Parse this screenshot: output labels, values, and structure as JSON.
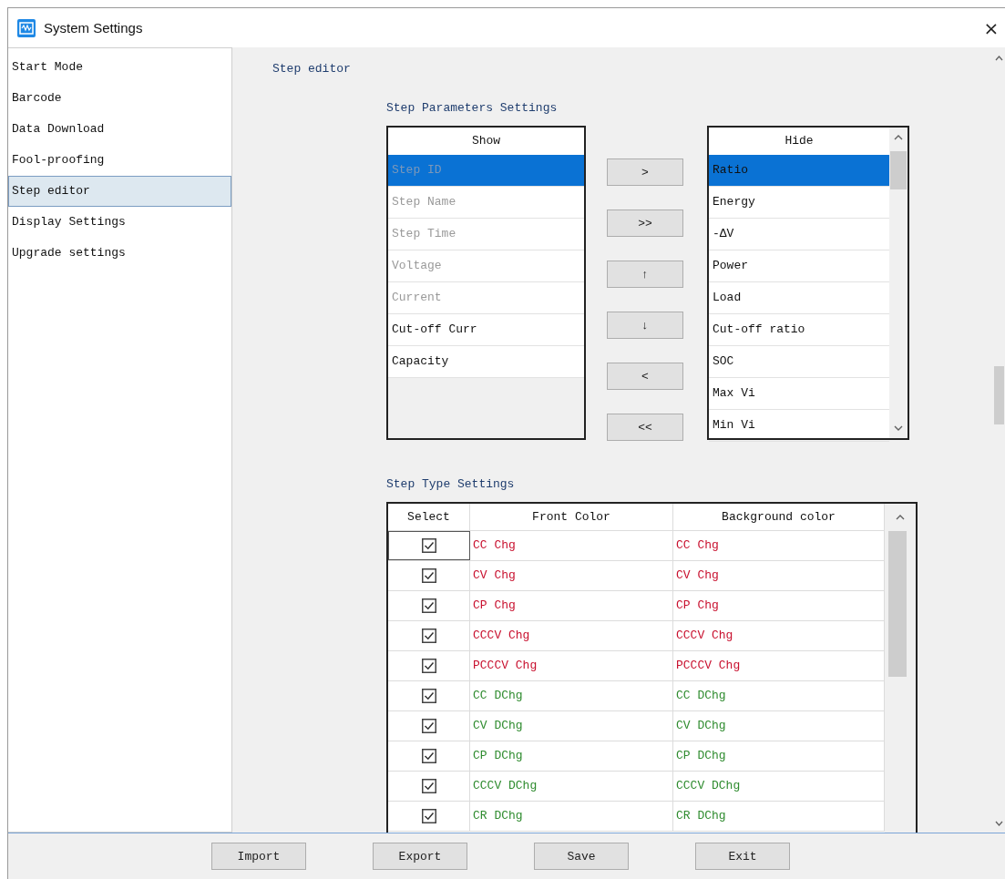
{
  "window": {
    "title": "System Settings",
    "close": "×"
  },
  "sidebar": {
    "items": [
      {
        "label": "Start Mode",
        "selected": false
      },
      {
        "label": "Barcode",
        "selected": false
      },
      {
        "label": "Data Download",
        "selected": false
      },
      {
        "label": "Fool-proofing",
        "selected": false
      },
      {
        "label": "Step editor",
        "selected": true
      },
      {
        "label": "Display Settings",
        "selected": false
      },
      {
        "label": "Upgrade settings",
        "selected": false
      }
    ]
  },
  "page_title": "Step editor",
  "step_parameters": {
    "title": "Step Parameters Settings",
    "show": {
      "header": "Show",
      "items": [
        {
          "label": "Step ID",
          "selected": true,
          "disabled": true
        },
        {
          "label": "Step Name",
          "selected": false,
          "disabled": true
        },
        {
          "label": "Step Time",
          "selected": false,
          "disabled": true
        },
        {
          "label": "Voltage",
          "selected": false,
          "disabled": true
        },
        {
          "label": "Current",
          "selected": false,
          "disabled": true
        },
        {
          "label": "Cut-off Curr",
          "selected": false,
          "disabled": false
        },
        {
          "label": "Capacity",
          "selected": false,
          "disabled": false
        }
      ]
    },
    "move_buttons": [
      ">",
      ">>",
      "↑",
      "↓",
      "<",
      "<<"
    ],
    "hide": {
      "header": "Hide",
      "items": [
        {
          "label": "Ratio",
          "selected": true
        },
        {
          "label": "Energy",
          "selected": false
        },
        {
          "label": "-ΔV",
          "selected": false
        },
        {
          "label": "Power",
          "selected": false
        },
        {
          "label": "Load",
          "selected": false
        },
        {
          "label": "Cut-off ratio",
          "selected": false
        },
        {
          "label": "SOC",
          "selected": false
        },
        {
          "label": "Max Vi",
          "selected": false
        },
        {
          "label": "Min Vi",
          "selected": false
        }
      ]
    }
  },
  "step_types": {
    "title": "Step Type Settings",
    "columns": [
      "Select",
      "Front Color",
      "Background color"
    ],
    "rows": [
      {
        "checked": true,
        "front": "CC Chg",
        "background": "CC Chg",
        "color": "#c8102e"
      },
      {
        "checked": true,
        "front": "CV Chg",
        "background": "CV Chg",
        "color": "#c8102e"
      },
      {
        "checked": true,
        "front": "CP Chg",
        "background": "CP Chg",
        "color": "#c8102e"
      },
      {
        "checked": true,
        "front": "CCCV Chg",
        "background": "CCCV Chg",
        "color": "#c8102e"
      },
      {
        "checked": true,
        "front": "PCCCV Chg",
        "background": "PCCCV Chg",
        "color": "#c8102e"
      },
      {
        "checked": true,
        "front": "CC DChg",
        "background": "CC DChg",
        "color": "#2e8b2e"
      },
      {
        "checked": true,
        "front": "CV DChg",
        "background": "CV DChg",
        "color": "#2e8b2e"
      },
      {
        "checked": true,
        "front": "CP DChg",
        "background": "CP DChg",
        "color": "#2e8b2e"
      },
      {
        "checked": true,
        "front": "CCCV DChg",
        "background": "CCCV DChg",
        "color": "#2e8b2e"
      },
      {
        "checked": true,
        "front": "CR DChg",
        "background": "CR DChg",
        "color": "#2e8b2e"
      }
    ]
  },
  "buttons": [
    "Import",
    "Export",
    "Save",
    "Exit"
  ]
}
